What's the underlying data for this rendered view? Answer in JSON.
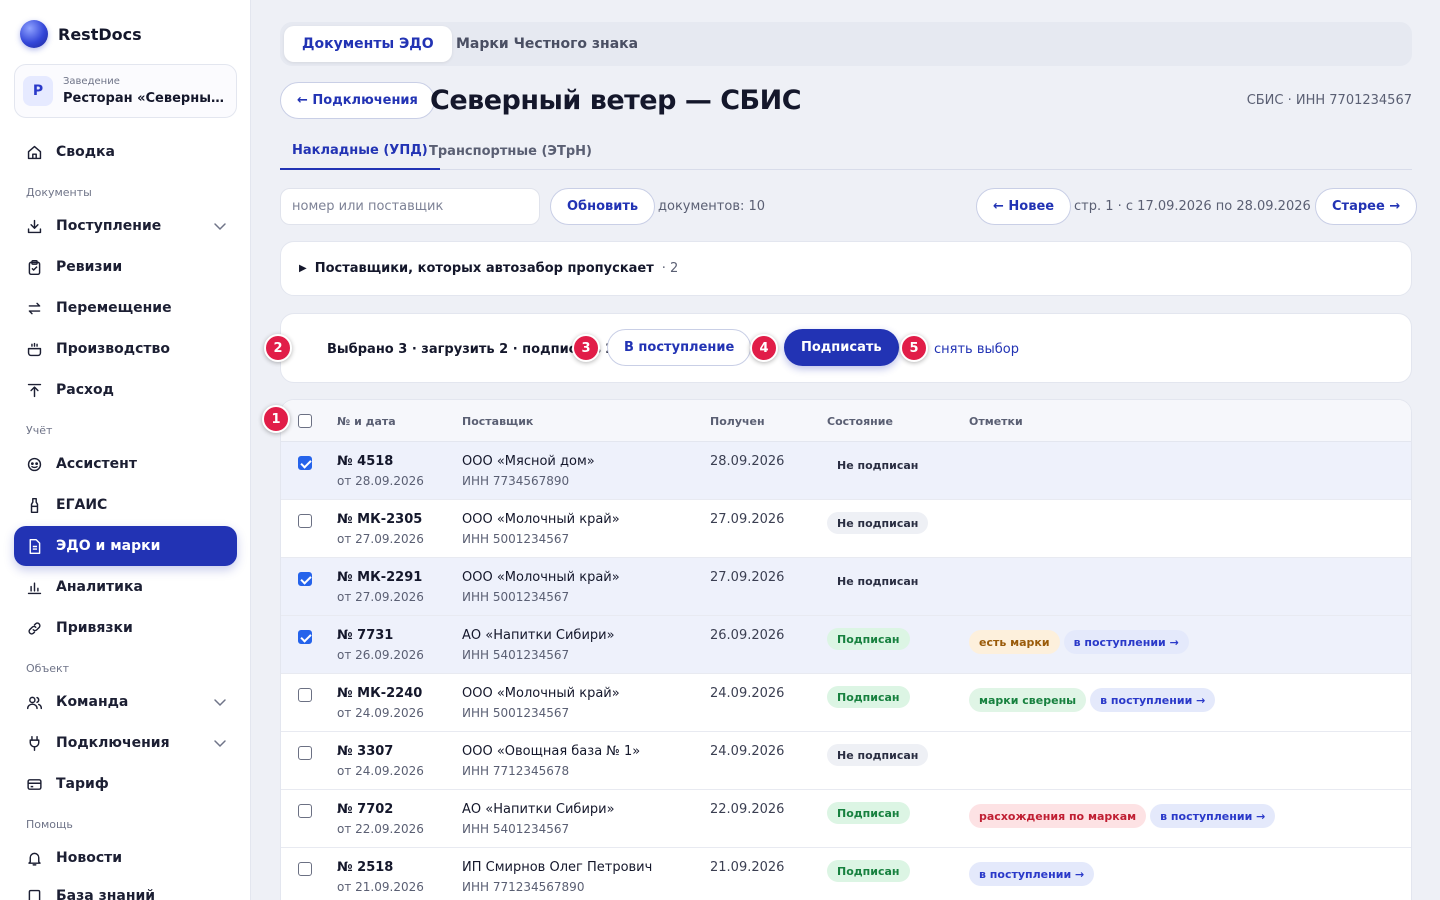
{
  "app": {
    "name": "RestDocs"
  },
  "venue": {
    "avatar": "Р",
    "caption": "Заведение",
    "name": "Ресторан «Северный ветер»"
  },
  "sidebar": {
    "sections": {
      "documents": "Документы",
      "accounting": "Учёт",
      "object": "Объект",
      "help": "Помощь"
    },
    "items": [
      {
        "label": "Сводка",
        "icon": "home-icon"
      },
      {
        "label": "Поступление",
        "icon": "download-icon"
      },
      {
        "label": "Ревизии",
        "icon": "clipboard-icon"
      },
      {
        "label": "Перемещение",
        "icon": "transfer-icon"
      },
      {
        "label": "Производство",
        "icon": "pot-icon"
      },
      {
        "label": "Расход",
        "icon": "upload-icon"
      },
      {
        "label": "Ассистент",
        "icon": "assistant-icon"
      },
      {
        "label": "ЕГАИС",
        "icon": "bottle-icon"
      },
      {
        "label": "ЭДО и марки",
        "icon": "document-icon",
        "active": true
      },
      {
        "label": "Аналитика",
        "icon": "chart-icon"
      },
      {
        "label": "Привязки",
        "icon": "link-icon"
      },
      {
        "label": "Команда",
        "icon": "team-icon"
      },
      {
        "label": "Подключения",
        "icon": "plug-icon"
      },
      {
        "label": "Тариф",
        "icon": "card-icon"
      },
      {
        "label": "Новости",
        "icon": "bell-icon"
      },
      {
        "label": "База знаний",
        "icon": "book-icon"
      }
    ]
  },
  "top_tabs": [
    {
      "label": "Документы ЭДО",
      "active": true
    },
    {
      "label": "Марки Честного знака",
      "active": false
    }
  ],
  "header": {
    "back_label": "← Подключения",
    "title": "Северный ветер — СБИС",
    "meta": "СБИС · ИНН 7701234567"
  },
  "sub_tabs": [
    {
      "label": "Накладные (УПД)",
      "active": true
    },
    {
      "label": "Транспортные (ЭТрН)",
      "active": false
    }
  ],
  "toolbar": {
    "search_placeholder": "номер или поставщик",
    "refresh_label": "Обновить",
    "doc_count": "документов: 10",
    "newer_label": "← Новее",
    "page_info": "стр. 1 · с 17.09.2026 по 28.09.2026",
    "older_label": "Старее →"
  },
  "skipped": {
    "label": "Поставщики, которых автозабор пропускает",
    "count": "· 2"
  },
  "selection": {
    "text": "Выбрано 3 · загрузить 2 · подписать 2",
    "to_receipt_label": "В поступление",
    "sign_label": "Подписать",
    "clear_label": "снять выбор"
  },
  "callouts": [
    "1",
    "2",
    "3",
    "4",
    "5"
  ],
  "table": {
    "columns": [
      "№ и дата",
      "Поставщик",
      "Получен",
      "Состояние",
      "Отметки"
    ],
    "rows": [
      {
        "selected": true,
        "number": "№ 4518",
        "date": "от 28.09.2026",
        "supplier": "ООО «Мясной дом»",
        "inn": "ИНН 7734567890",
        "received": "28.09.2026",
        "status": "Не подписан",
        "status_kind": "unsigned",
        "marks": []
      },
      {
        "selected": false,
        "number": "№ МК-2305",
        "date": "от 27.09.2026",
        "supplier": "ООО «Молочный край»",
        "inn": "ИНН 5001234567",
        "received": "27.09.2026",
        "status": "Не подписан",
        "status_kind": "unsigned",
        "marks": []
      },
      {
        "selected": true,
        "number": "№ МК-2291",
        "date": "от 27.09.2026",
        "supplier": "ООО «Молочный край»",
        "inn": "ИНН 5001234567",
        "received": "27.09.2026",
        "status": "Не подписан",
        "status_kind": "unsigned",
        "marks": []
      },
      {
        "selected": true,
        "number": "№ 7731",
        "date": "от 26.09.2026",
        "supplier": "АО «Напитки Сибири»",
        "inn": "ИНН 5401234567",
        "received": "26.09.2026",
        "status": "Подписан",
        "status_kind": "signed",
        "marks": [
          {
            "label": "есть марки",
            "kind": "orange"
          },
          {
            "label": "в поступлении →",
            "kind": "blue"
          }
        ]
      },
      {
        "selected": false,
        "number": "№ МК-2240",
        "date": "от 24.09.2026",
        "supplier": "ООО «Молочный край»",
        "inn": "ИНН 5001234567",
        "received": "24.09.2026",
        "status": "Подписан",
        "status_kind": "signed",
        "marks": [
          {
            "label": "марки сверены",
            "kind": "green"
          },
          {
            "label": "в поступлении →",
            "kind": "blue"
          }
        ]
      },
      {
        "selected": false,
        "number": "№ 3307",
        "date": "от 24.09.2026",
        "supplier": "ООО «Овощная база № 1»",
        "inn": "ИНН 7712345678",
        "received": "24.09.2026",
        "status": "Не подписан",
        "status_kind": "unsigned",
        "marks": []
      },
      {
        "selected": false,
        "number": "№ 7702",
        "date": "от 22.09.2026",
        "supplier": "АО «Напитки Сибири»",
        "inn": "ИНН 5401234567",
        "received": "22.09.2026",
        "status": "Подписан",
        "status_kind": "signed",
        "marks": [
          {
            "label": "расхождения по маркам",
            "kind": "red"
          },
          {
            "label": "в поступлении →",
            "kind": "blue"
          }
        ]
      },
      {
        "selected": false,
        "number": "№ 2518",
        "date": "от 21.09.2026",
        "supplier": "ИП Смирнов Олег Петрович",
        "inn": "ИНН 771234567890",
        "received": "21.09.2026",
        "status": "Подписан",
        "status_kind": "signed",
        "marks": [
          {
            "label": "в поступлении →",
            "kind": "blue"
          }
        ]
      }
    ]
  },
  "colors": {
    "accent": "#2233b4",
    "callout": "#e11d48",
    "signed": "#17813f"
  }
}
